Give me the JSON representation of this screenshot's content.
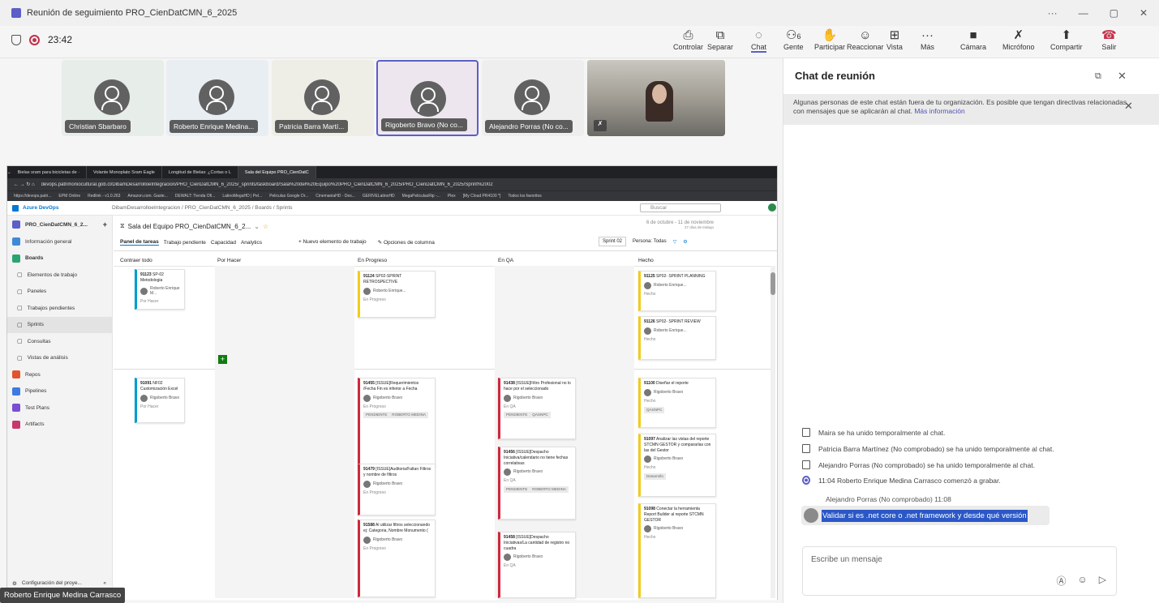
{
  "window": {
    "title": "Reunión de seguimiento PRO_CienDatCMN_6_2025",
    "controls": [
      "···",
      "—",
      "▢",
      "✕"
    ]
  },
  "toolbar": {
    "timer": "23:42",
    "buttons": [
      {
        "label": "Controlar",
        "icon": "control-icon",
        "glyph": "⎙"
      },
      {
        "label": "Separar",
        "icon": "pop-out-icon",
        "glyph": "⧉"
      },
      {
        "label": "Chat",
        "icon": "chat-icon",
        "glyph": "◌"
      },
      {
        "label": "Gente",
        "icon": "people-icon",
        "glyph": "⚇",
        "badge": "6"
      },
      {
        "label": "Participar",
        "icon": "raise-hand-icon",
        "glyph": "✋"
      },
      {
        "label": "Reaccionar",
        "icon": "react-icon",
        "glyph": "☺"
      },
      {
        "label": "Vista",
        "icon": "view-icon",
        "glyph": "⊞"
      },
      {
        "label": "Más",
        "icon": "more-icon",
        "glyph": "···"
      },
      {
        "label": "Cámara",
        "icon": "camera-icon",
        "glyph": "■"
      },
      {
        "label": "Micrófono",
        "icon": "mic-off-icon",
        "glyph": "✗"
      },
      {
        "label": "Compartir",
        "icon": "share-icon",
        "glyph": "⬆"
      },
      {
        "label": "Salir",
        "icon": "leave-call-icon",
        "glyph": "☎"
      }
    ]
  },
  "participants": [
    {
      "name": "Christian Sbarbaro",
      "bg": "#e7ede9"
    },
    {
      "name": "Roberto Enrique Medina...",
      "bg": "#e9eef3"
    },
    {
      "name": "Patricia Barra Martí...",
      "bg": "#efeee6"
    },
    {
      "name": "Rigoberto Bravo (No co...",
      "bg": "#eee6ef"
    },
    {
      "name": "Alejandro Porras (No co...",
      "bg": "#eeeeee"
    }
  ],
  "shared": {
    "tabs": [
      "Bielas sram para bicicletas de ·",
      "Volante Monoplato Sram Eagle",
      "Longitud de Bielas: ¿Cortas o L",
      "Sala del Equipo PRO_CienDatC"
    ],
    "url": "devops.patrimoniocultural.gob.cl/DibamDesarrolloeIntegracion/PRO_CienDatCMN_6_2025/_sprints/taskboard/Sala%20del%20Equipo%20PRO_CienDatCMN_6_2025/PRO_CienDatCMN_6_2025/Sprint%2002",
    "bookmarks": [
      "https://devops.patri...",
      "EPM Online",
      "Redlink - v1.0.263",
      "Amazon.com. Gaste...",
      "DEWALT: Tienda Ofi...",
      "LatinoMegaHD | Pel...",
      "Peliculas Google Dr...",
      "CinemaniaHD - Des...",
      "GERIVELatinoHD",
      "MegaPeliculasRip -...",
      "Plex",
      "[My Cloud PR4100 *]",
      "Todos los favoritos"
    ],
    "brand": "Azure DevOps",
    "breadcrumb": "DibamDesarrolloeIntegracion  /  PRO_CienDatCMN_6_2025  /  Boards  /  Sprints",
    "search": "Buscar",
    "project": "PRO_CienDatCMN_6_2...",
    "nav": [
      "Información general",
      "Boards",
      "Elementos de trabajo",
      "Paneles",
      "Trabajos pendientes",
      "Sprints",
      "Consultas",
      "Vistas de análisis",
      "Repos",
      "Pipelines",
      "Test Plans",
      "Artifacts"
    ],
    "settings": "Configuración del proye...",
    "team": "Sala del Equipo PRO_CienDatCMN_6_2...",
    "dates": "6 de octubre - 11 de noviembre",
    "days": "27 días de trabajo",
    "subtabs": [
      "Panel de tareas",
      "Trabajo pendiente",
      "Capacidad",
      "Analytics"
    ],
    "new_item": "Nuevo elemento de trabajo",
    "col_options": "Opciones de columna",
    "sprint": "Sprint 02",
    "persona": "Persona: Todas",
    "collapse": "Contraer todo",
    "columns": [
      "Por Hacer",
      "En Progreso",
      "En QA",
      "Hecho"
    ],
    "cards": [
      {
        "id": "91123",
        "title": "SP-02 Metodologia",
        "who": "Roberto Enrique M...",
        "state": "Por Hacer",
        "color": "blue",
        "tags": []
      },
      {
        "id": "91091",
        "title": "NF02 Customización Excel",
        "who": "Rigoberto Bravo",
        "state": "Por Hacer",
        "color": "blue",
        "tags": []
      },
      {
        "id": "91124",
        "title": "SP02-SPRINT RETROSPECTIVE",
        "who": "Roberto Enrique...",
        "state": "En Progreso",
        "color": "yellow",
        "tags": []
      },
      {
        "id": "91455",
        "title": "[ISSUE]Requerimientos /Fecha Fin es inferior a Fecha",
        "who": "Rigoberto Bravo",
        "state": "En Progreso",
        "color": "red",
        "tags": [
          "PENDIENTE",
          "ROBERTO MEDINA"
        ]
      },
      {
        "id": "91479",
        "title": "[ISSUE]Auditoria/Faltan Filtros y nombre de filtros",
        "who": "Rigoberto Bravo",
        "state": "En Progreso",
        "color": "red",
        "tags": []
      },
      {
        "id": "91588",
        "title": "Al utilizar filtros seleccionando ej: Categoria, Nombre Monumento (",
        "who": "Rigoberto Bravo",
        "state": "En Progreso",
        "color": "red",
        "tags": []
      },
      {
        "id": "91438",
        "title": "[ISSUE]Filtro Profesional no lo hace por el seleccionado",
        "who": "Rigoberto Bravo",
        "state": "En QA",
        "color": "red",
        "tags": [
          "PENDIENTE",
          "QASNPC"
        ]
      },
      {
        "id": "91456",
        "title": "[ISSUE]Despacho Iniciativa/calendario no tiene fechas correlativas",
        "who": "Rigoberto Bravo",
        "state": "En QA",
        "color": "red",
        "tags": [
          "PENDIENTE",
          "ROBERTO MEDINA"
        ]
      },
      {
        "id": "91458",
        "title": "[ISSUE]Despacho Iniciativas/La cantidad de registro no cuadra",
        "who": "Rigoberto Bravo",
        "state": "En QA",
        "color": "red",
        "tags": []
      },
      {
        "id": "91125",
        "title": "SP02- SPRINT PLANNING",
        "who": "Roberto Enrique...",
        "state": "Hecho",
        "color": "yellow",
        "tags": []
      },
      {
        "id": "91126",
        "title": "SP02- SPRINT REVIEW",
        "who": "Roberto Enrique...",
        "state": "Hecho",
        "color": "yellow",
        "tags": []
      },
      {
        "id": "91100",
        "title": "Diseñar el reporte",
        "who": "Rigoberto Bravo",
        "state": "Hecho",
        "color": "yellow",
        "tags": [
          "QASNPC"
        ]
      },
      {
        "id": "91097",
        "title": "Analizar las vistas del reporte STCMN GESTOR y compararlas con las del Gestor",
        "who": "Rigoberto Bravo",
        "state": "Hecho",
        "color": "yellow",
        "tags": [
          "Desarrollo"
        ]
      },
      {
        "id": "91098",
        "title": "Conectar la herramienta Report Builder al reporte STCMN GESTOR",
        "who": "Rigoberto Bravo",
        "state": "Hecho",
        "color": "yellow",
        "tags": []
      }
    ]
  },
  "bottom_name": "Roberto Enrique Medina Carrasco",
  "chat": {
    "title": "Chat de reunión",
    "banner": "Algunas personas de este chat están fuera de tu organización. Es posible que tengan directivas relacionadas con mensajes que se aplicarán al chat.",
    "banner_link": "Más información",
    "system": [
      "Maira se ha unido temporalmente al chat.",
      "Patricia Barra Martínez (No comprobado) se ha unido temporalmente al chat.",
      "Alejandro Porras (No comprobado) se ha unido temporalmente al chat."
    ],
    "recording": "11:04   Roberto Enrique Medina Carrasco comenzó a grabar.",
    "msg_author": "Alejandro Porras (No comprobado)  11:08",
    "msg_text": "Validar si es .net core o .net framework y desde qué versión",
    "compose_placeholder": "Escribe un mensaje"
  },
  "colors": {
    "accent": "#5b5fc7",
    "leave": "#c4314b",
    "highlight": "#2b58c7"
  }
}
